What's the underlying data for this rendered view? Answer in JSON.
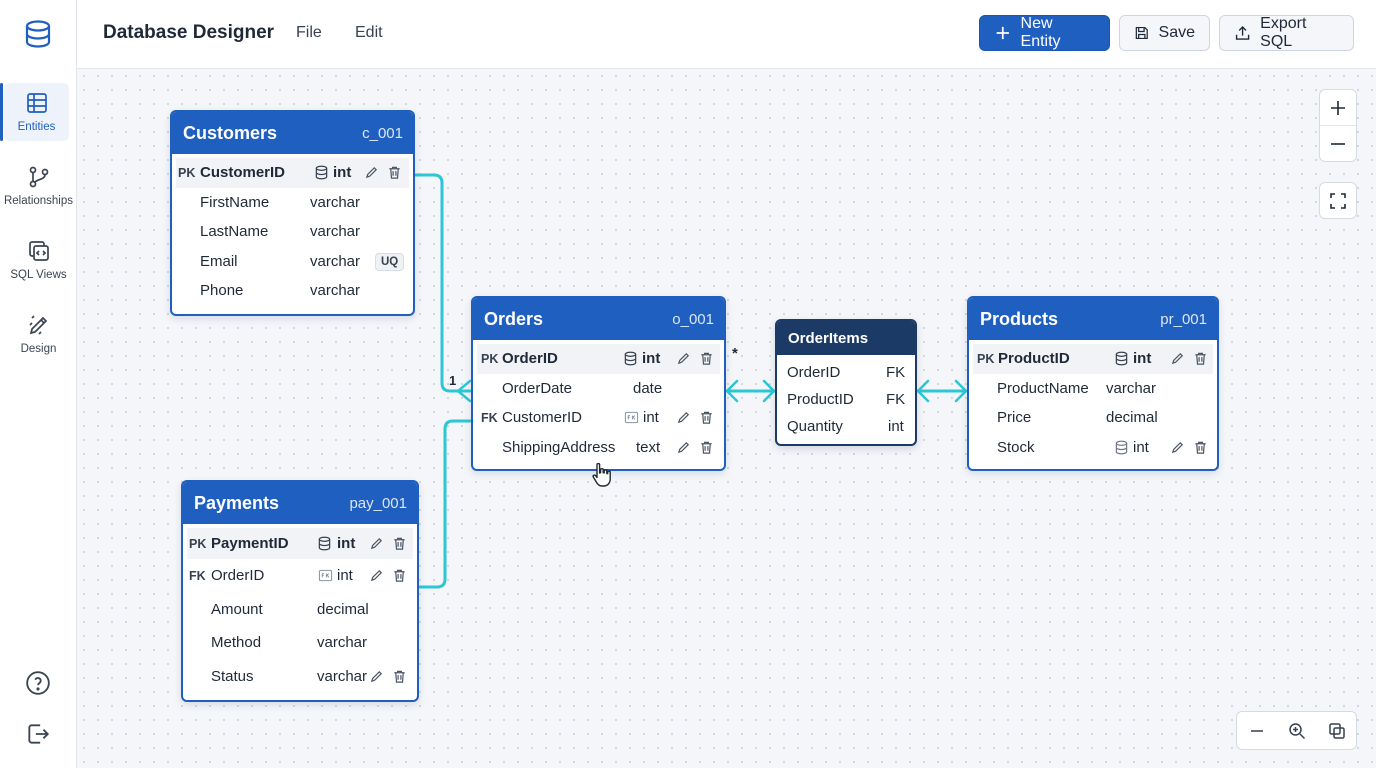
{
  "app": {
    "title": "Database Designer"
  },
  "menu": {
    "file": "File",
    "edit": "Edit"
  },
  "toolbar": {
    "new_entity": "New Entity",
    "save": "Save",
    "export_sql": "Export SQL"
  },
  "sidebar": {
    "items": [
      {
        "label": "Entities",
        "icon": "table-icon",
        "active": true
      },
      {
        "label": "Relationships",
        "icon": "branch-icon",
        "active": false
      },
      {
        "label": "SQL Views",
        "icon": "code-window-icon",
        "active": false
      },
      {
        "label": "Design",
        "icon": "pen-ruler-icon",
        "active": false
      }
    ],
    "help_icon": "help-icon",
    "logout_icon": "logout-icon"
  },
  "colors": {
    "accent": "#1f5fbf",
    "junction": "#1b3a66",
    "link": "#2cc7d6"
  },
  "entities": {
    "customers": {
      "name": "Customers",
      "code": "c_001",
      "fields": [
        {
          "key": "PK",
          "name": "CustomerID",
          "type": "int"
        },
        {
          "key": "",
          "name": "FirstName",
          "type": "varchar"
        },
        {
          "key": "",
          "name": "LastName",
          "type": "varchar"
        },
        {
          "key": "",
          "name": "Email",
          "type": "varchar",
          "badge": "UQ"
        },
        {
          "key": "",
          "name": "Phone",
          "type": "varchar"
        }
      ]
    },
    "orders": {
      "name": "Orders",
      "code": "o_001",
      "fields": [
        {
          "key": "PK",
          "name": "OrderID",
          "type": "int"
        },
        {
          "key": "",
          "name": "OrderDate",
          "type": "date"
        },
        {
          "key": "FK",
          "name": "CustomerID",
          "type": "int"
        },
        {
          "key": "",
          "name": "ShippingAddress",
          "type": "text"
        }
      ]
    },
    "orderitems": {
      "name": "OrderItems",
      "fields": [
        {
          "name": "OrderID",
          "type": "FK"
        },
        {
          "name": "ProductID",
          "type": "FK"
        },
        {
          "name": "Quantity",
          "type": "int"
        }
      ]
    },
    "products": {
      "name": "Products",
      "code": "pr_001",
      "fields": [
        {
          "key": "PK",
          "name": "ProductID",
          "type": "int"
        },
        {
          "key": "",
          "name": "ProductName",
          "type": "varchar"
        },
        {
          "key": "",
          "name": "Price",
          "type": "decimal"
        },
        {
          "key": "",
          "name": "Stock",
          "type": "int"
        }
      ]
    },
    "payments": {
      "name": "Payments",
      "code": "pay_001",
      "fields": [
        {
          "key": "PK",
          "name": "PaymentID",
          "type": "int"
        },
        {
          "key": "FK",
          "name": "OrderID",
          "type": "int"
        },
        {
          "key": "",
          "name": "Amount",
          "type": "decimal"
        },
        {
          "key": "",
          "name": "Method",
          "type": "varchar"
        },
        {
          "key": "",
          "name": "Status",
          "type": "varchar"
        }
      ]
    }
  },
  "relations": {
    "one": "1",
    "many": "*"
  }
}
